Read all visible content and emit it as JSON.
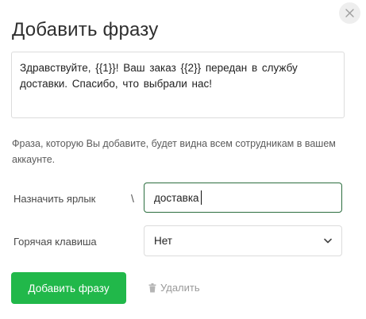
{
  "dialog": {
    "title": "Добавить фразу",
    "close_icon": "close-icon"
  },
  "phrase": {
    "text": "Здравствуйте, {{1}}! Ваш заказ {{2}} передан в службу доставки. Спасибо, что выбрали нас!"
  },
  "hint": {
    "text": "Фраза, которую Вы добавите, будет видна всем сотрудникам в вашем аккаунте."
  },
  "tag": {
    "label": "Назначить ярлык",
    "prefix": "\\",
    "value": "доставка"
  },
  "hotkey": {
    "label": "Горячая клавиша",
    "selected": "Нет",
    "icon": "chevron-down-icon"
  },
  "actions": {
    "add_label": "Добавить фразу",
    "delete_label": "Удалить",
    "delete_icon": "trash-icon"
  },
  "colors": {
    "primary_button": "#21b84a",
    "input_focus_border": "#2c6e3f"
  }
}
